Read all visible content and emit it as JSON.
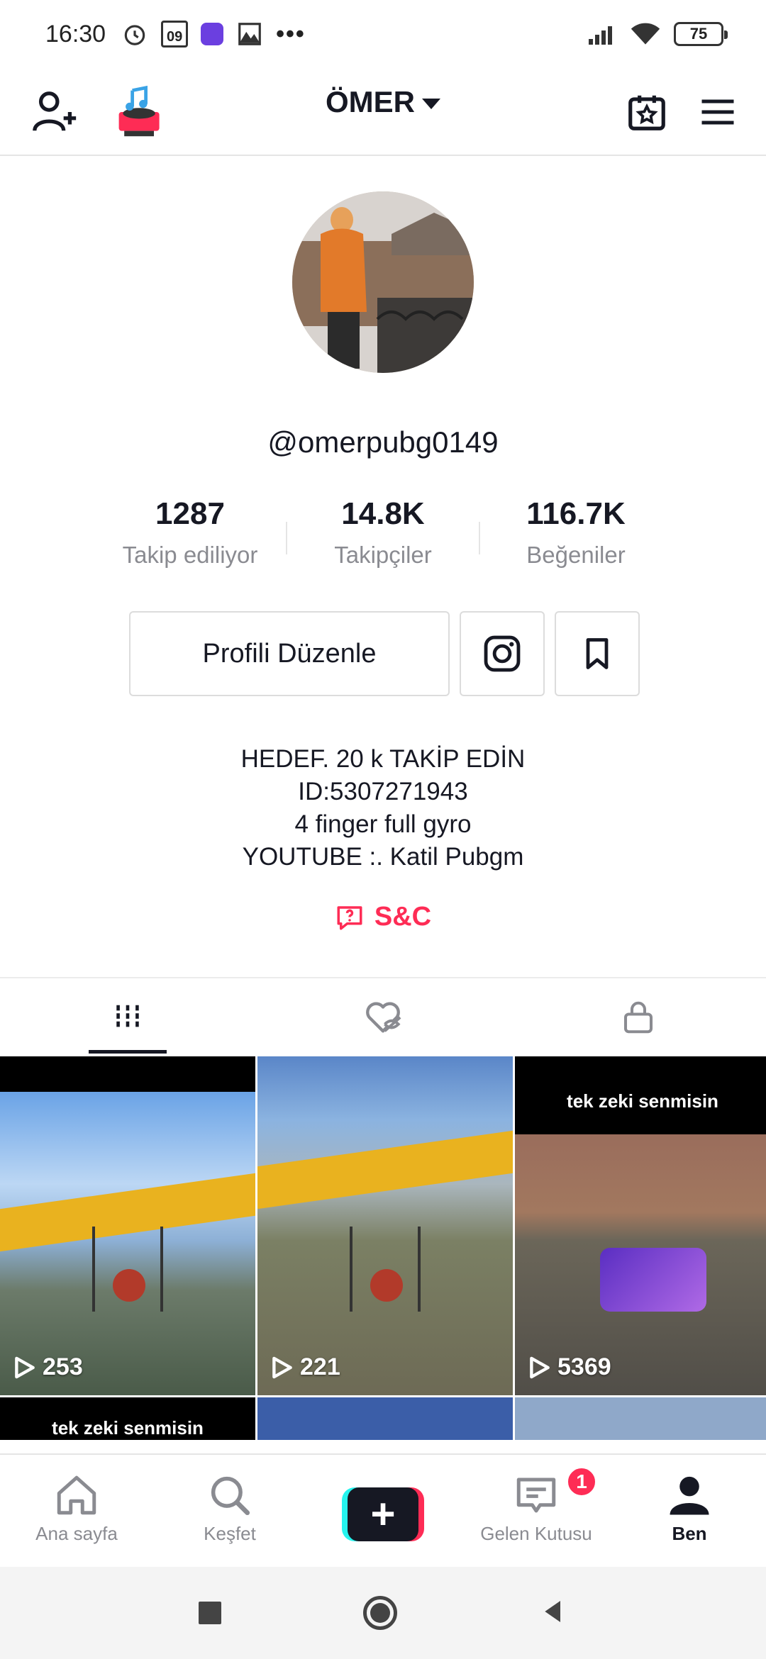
{
  "status_bar": {
    "time": "16:30",
    "date_icon_text": "09",
    "battery": "75",
    "icons": [
      "alarm-icon",
      "calendar-icon",
      "app-icon",
      "gallery-icon",
      "more-icon",
      "signal-icon",
      "wifi-icon",
      "battery-icon"
    ]
  },
  "top_bar": {
    "title": "ÖMER",
    "icons": [
      "add-user-icon",
      "music-player-icon",
      "calendar-star-icon",
      "menu-icon"
    ]
  },
  "profile": {
    "username": "@omerpubg0149",
    "stats": [
      {
        "value": "1287",
        "label": "Takip ediliyor"
      },
      {
        "value": "14.8K",
        "label": "Takipçiler"
      },
      {
        "value": "116.7K",
        "label": "Beğeniler"
      }
    ],
    "edit_button": "Profili Düzenle",
    "bio_lines": [
      "HEDEF. 20 k TAKİP EDİN",
      "ID:5307271943",
      "4 finger full gyro",
      "YOUTUBE :. Katil Pubgm"
    ],
    "qa_label": "S&C"
  },
  "tabs": [
    "videos-tab",
    "liked-tab",
    "private-tab"
  ],
  "videos": [
    {
      "views": "253",
      "caption": ""
    },
    {
      "views": "221",
      "caption": ""
    },
    {
      "views": "5369",
      "caption": "tek zeki senmisin"
    },
    {
      "views": "",
      "caption": "tek zeki senmisin"
    },
    {
      "views": "",
      "caption": ""
    },
    {
      "views": "",
      "caption": ""
    }
  ],
  "bottom_nav": {
    "home": "Ana sayfa",
    "discover": "Keşfet",
    "create": "+",
    "inbox": "Gelen Kutusu",
    "inbox_badge": "1",
    "me": "Ben"
  },
  "colors": {
    "accent": "#fe2c55",
    "cyan": "#25f4ee",
    "text": "#161823",
    "muted": "#8a8b91"
  }
}
